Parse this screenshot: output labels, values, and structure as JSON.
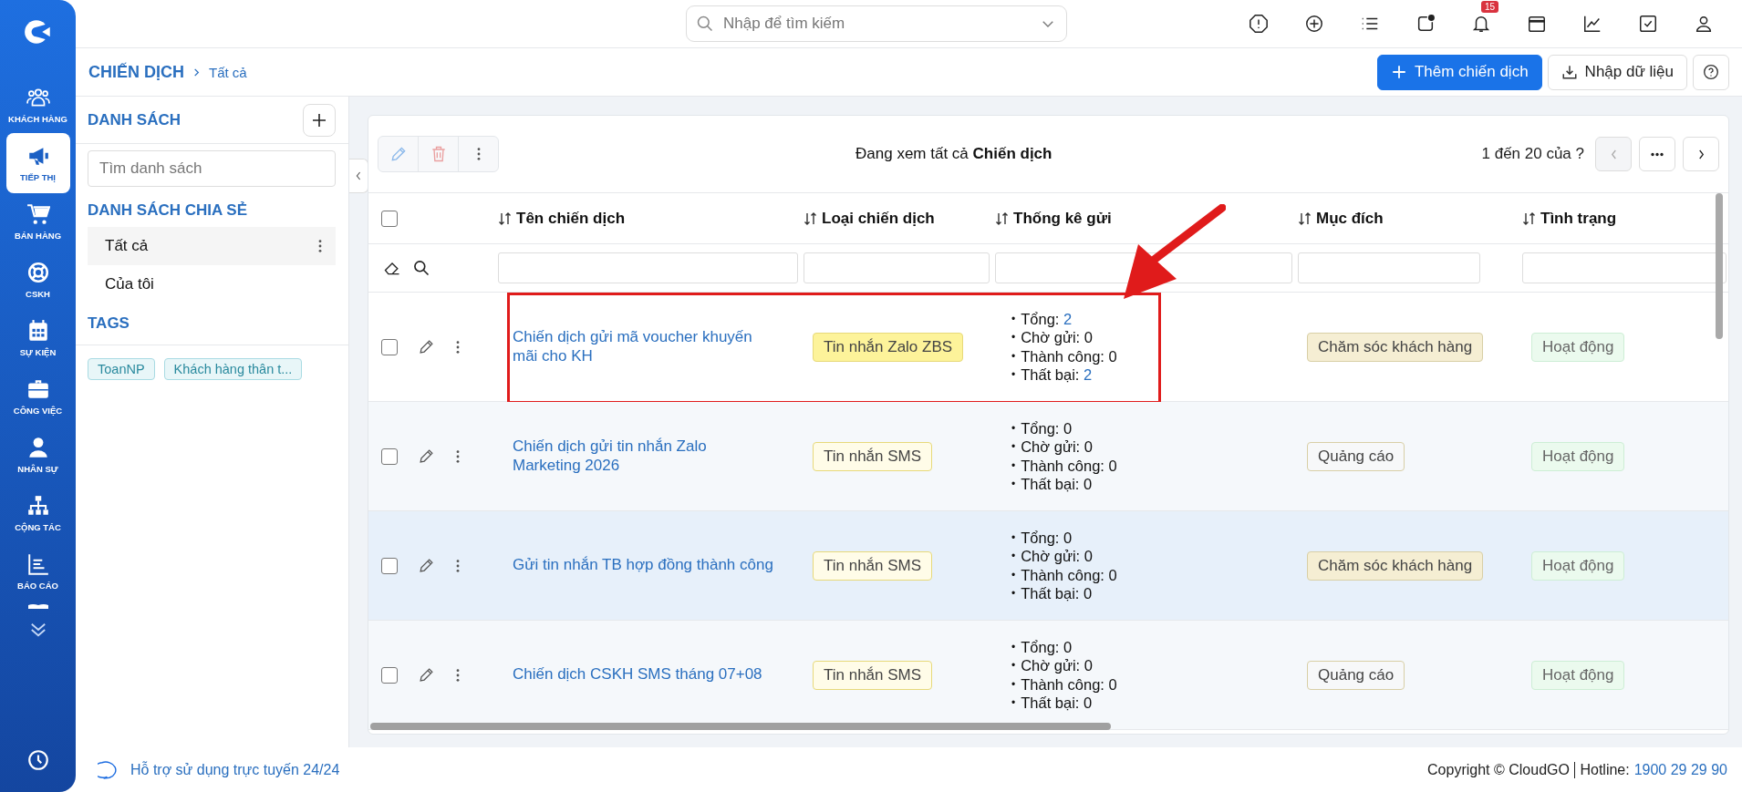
{
  "rail": {
    "items": [
      {
        "label": "KHÁCH HÀNG",
        "selected": false
      },
      {
        "label": "TIẾP THỊ",
        "selected": true
      },
      {
        "label": "BÁN HÀNG",
        "selected": false
      },
      {
        "label": "CSKH",
        "selected": false
      },
      {
        "label": "SỰ KIỆN",
        "selected": false
      },
      {
        "label": "CÔNG VIỆC",
        "selected": false
      },
      {
        "label": "NHÂN SỰ",
        "selected": false
      },
      {
        "label": "CỘNG TÁC",
        "selected": false
      },
      {
        "label": "BÁO CÁO",
        "selected": false
      }
    ]
  },
  "topbar": {
    "search": {
      "placeholder": "Nhập để tìm kiếm"
    },
    "notification_badge": "15"
  },
  "breadcrumb": {
    "section": "CHIẾN DỊCH",
    "current": "Tất cả"
  },
  "actions": {
    "primary": "Thêm chiến dịch",
    "import": "Nhập dữ liệu"
  },
  "lists_panel": {
    "title": "DANH SÁCH",
    "search": {
      "placeholder": "Tìm danh sách"
    },
    "shared_title": "DANH SÁCH CHIA SẺ",
    "items": [
      {
        "label": "Tất cả",
        "selected": true
      },
      {
        "label": "Của tôi",
        "selected": false
      }
    ],
    "tags_title": "TAGS",
    "tags": [
      "ToanNP",
      "Khách hàng thân t..."
    ]
  },
  "table": {
    "select_all_checked": false,
    "bullet": "•",
    "caption_prefix": "Đang xem tất cả",
    "caption_bold": "Chiến dịch",
    "pagination": "1 đến 20 của",
    "pagination_total": "?",
    "columns": [
      "Tên chiến dịch",
      "Loại chiến dịch",
      "Thống kê gửi",
      "Mục đích",
      "Tình trạng"
    ],
    "rows": [
      {
        "checked": false,
        "highlighted": false,
        "annotated": true,
        "name": "Chiến dịch gửi mã voucher khuyến mãi cho KH",
        "type": {
          "label": "Tin nhắn Zalo ZBS",
          "color": "#fdf39a"
        },
        "stats": [
          {
            "label": "Tổng:",
            "value": "2",
            "link": true
          },
          {
            "label": "Chờ gửi:",
            "value": "0",
            "link": false
          },
          {
            "label": "Thành công:",
            "value": "0",
            "link": false
          },
          {
            "label": "Thất bại:",
            "value": "2",
            "link": true
          }
        ],
        "purpose": {
          "label": "Chăm sóc khách hàng",
          "color": "#f5eed3"
        },
        "status": "Hoạt động"
      },
      {
        "checked": false,
        "highlighted": false,
        "annotated": false,
        "name": "Chiến dịch gửi tin nhắn Zalo Marketing 2026",
        "type": {
          "label": "Tin nhắn SMS",
          "color": "#fffce8"
        },
        "stats": [
          {
            "label": "Tổng:",
            "value": "0",
            "link": false
          },
          {
            "label": "Chờ gửi:",
            "value": "0",
            "link": false
          },
          {
            "label": "Thành công:",
            "value": "0",
            "link": false
          },
          {
            "label": "Thất bại:",
            "value": "0",
            "link": false
          }
        ],
        "purpose": {
          "label": "Quảng cáo",
          "color": "#f7f8f9"
        },
        "status": "Hoạt động"
      },
      {
        "checked": false,
        "highlighted": true,
        "annotated": false,
        "name": "Gửi tin nhắn TB hợp đồng thành công",
        "type": {
          "label": "Tin nhắn SMS",
          "color": "#fffce8"
        },
        "stats": [
          {
            "label": "Tổng:",
            "value": "0",
            "link": false
          },
          {
            "label": "Chờ gửi:",
            "value": "0",
            "link": false
          },
          {
            "label": "Thành công:",
            "value": "0",
            "link": false
          },
          {
            "label": "Thất bại:",
            "value": "0",
            "link": false
          }
        ],
        "purpose": {
          "label": "Chăm sóc khách hàng",
          "color": "#f5eed3"
        },
        "status": "Hoạt động"
      },
      {
        "checked": false,
        "highlighted": false,
        "annotated": false,
        "name": "Chiến dịch CSKH SMS tháng 07+08",
        "type": {
          "label": "Tin nhắn SMS",
          "color": "#fffce8"
        },
        "stats": [
          {
            "label": "Tổng:",
            "value": "0",
            "link": false
          },
          {
            "label": "Chờ gửi:",
            "value": "0",
            "link": false
          },
          {
            "label": "Thành công:",
            "value": "0",
            "link": false
          },
          {
            "label": "Thất bại:",
            "value": "0",
            "link": false
          }
        ],
        "purpose": {
          "label": "Quảng cáo",
          "color": "#f7f8f9"
        },
        "status": "Hoạt động"
      }
    ]
  },
  "footer": {
    "support": "Hỗ trợ sử dụng trực tuyến 24/24",
    "copyright": "Copyright © CloudGO",
    "hotline_label": "Hotline:",
    "hotline": "1900 29 29 90"
  }
}
